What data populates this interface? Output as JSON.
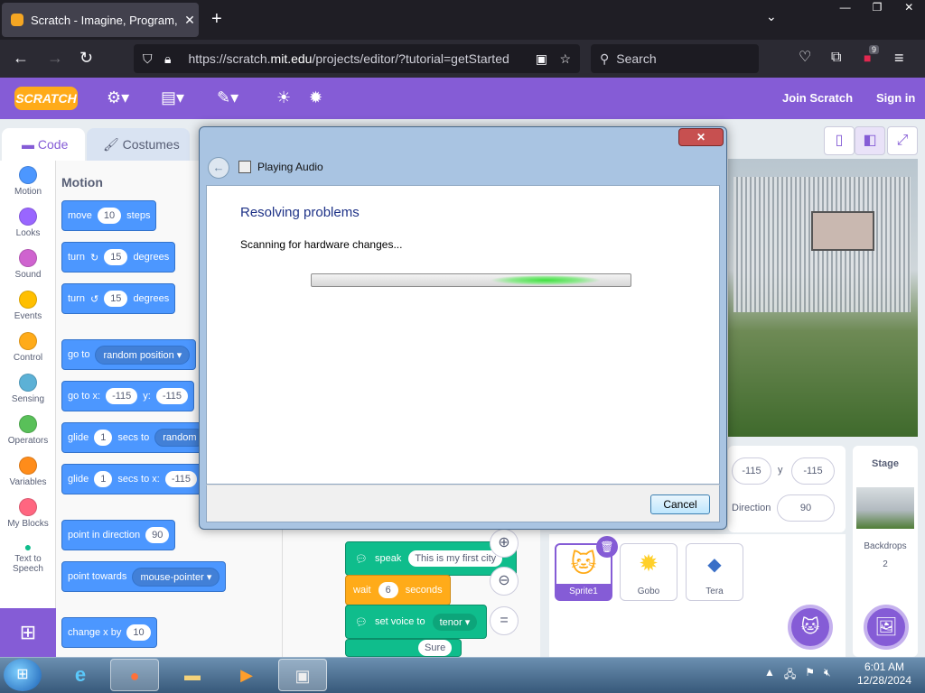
{
  "browser": {
    "tab_title": "Scratch - Imagine, Program, Sh",
    "tab_close": "✕",
    "new_tab": "+",
    "url_prefix": "https://scratch.",
    "url_domain": "mit.edu",
    "url_path": "/projects/editor/?tutorial=getStarted",
    "search_placeholder": "Search",
    "ext_badge": "9"
  },
  "scratch": {
    "logo": "SCRATCH",
    "join": "Join Scratch",
    "signin": "Sign in",
    "tab_code": "Code",
    "tab_costumes": "Costumes",
    "categories": [
      {
        "label": "Motion",
        "color": "#4c97ff"
      },
      {
        "label": "Looks",
        "color": "#9966ff"
      },
      {
        "label": "Sound",
        "color": "#cf63cf"
      },
      {
        "label": "Events",
        "color": "#ffbf00"
      },
      {
        "label": "Control",
        "color": "#ffab19"
      },
      {
        "label": "Sensing",
        "color": "#5cb1d6"
      },
      {
        "label": "Operators",
        "color": "#59c059"
      },
      {
        "label": "Variables",
        "color": "#ff8c1a"
      },
      {
        "label": "My Blocks",
        "color": "#ff6680"
      },
      {
        "label": "Text to Speech",
        "color": "#0fbd8c"
      }
    ],
    "motion_header": "Motion",
    "blocks": {
      "move": {
        "pre": "move",
        "val": "10",
        "post": "steps"
      },
      "turn_cw": {
        "pre": "turn",
        "val": "15",
        "post": "degrees"
      },
      "turn_ccw": {
        "pre": "turn",
        "val": "15",
        "post": "degrees"
      },
      "goto": {
        "pre": "go to",
        "dd": "random position"
      },
      "gotoxy": {
        "pre": "go to x:",
        "x": "-115",
        "ylbl": "y:",
        "y": "-115"
      },
      "glide1": {
        "pre": "glide",
        "val": "1",
        "mid": "secs to",
        "dd": "random"
      },
      "glide2": {
        "pre": "glide",
        "val": "1",
        "mid": "secs to x:",
        "x": "-115"
      },
      "point_dir": {
        "pre": "point in direction",
        "val": "90"
      },
      "point_towards": {
        "pre": "point towards",
        "dd": "mouse-pointer"
      },
      "change_x": {
        "pre": "change x by",
        "val": "10"
      }
    },
    "script": {
      "speak": {
        "pre": "speak",
        "val": "This is my first city"
      },
      "wait": {
        "pre": "wait",
        "val": "6",
        "post": "seconds"
      },
      "voice": {
        "pre": "set voice to",
        "dd": "tenor"
      },
      "partial": "Sure"
    },
    "sprite_info": {
      "x": "-115",
      "ylbl": "y",
      "y": "-115",
      "dir_label": "Direction",
      "dir": "90"
    },
    "sprites": [
      {
        "label": "Sprite1"
      },
      {
        "label": "Gobo"
      },
      {
        "label": "Tera"
      }
    ],
    "stage_panel": {
      "title": "Stage",
      "backdrops": "Backdrops",
      "count": "2"
    }
  },
  "dialog": {
    "title": "Playing Audio",
    "close": "✕",
    "heading": "Resolving problems",
    "status": "Scanning for hardware changes...",
    "cancel": "Cancel"
  },
  "taskbar": {
    "time": "6:01 AM",
    "date": "12/28/2024"
  }
}
